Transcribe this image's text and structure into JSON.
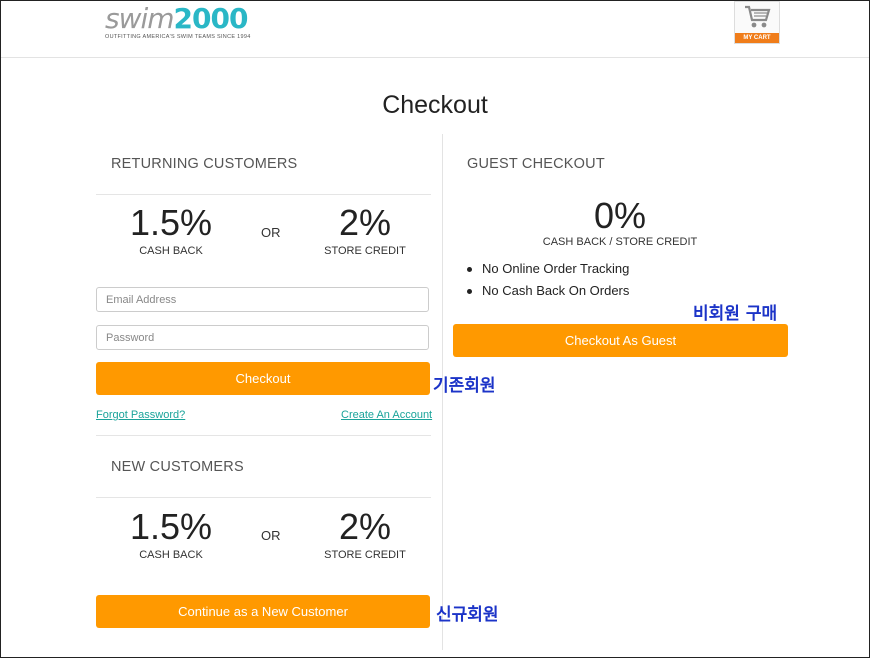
{
  "header": {
    "logo_word_1": "swim",
    "logo_word_2": "2000",
    "logo_tagline": "OUTFITTING AMERICA'S SWIM TEAMS SINCE 1994",
    "cart_label": "MY CART"
  },
  "page_title": "Checkout",
  "returning": {
    "title": "RETURNING CUSTOMERS",
    "cashback_value": "1.5%",
    "cashback_label": "CASH BACK",
    "or": "OR",
    "credit_value": "2%",
    "credit_label": "STORE CREDIT",
    "email_placeholder": "Email Address",
    "password_placeholder": "Password",
    "checkout_button": "Checkout",
    "forgot_link": "Forgot Password?",
    "create_link": "Create An Account"
  },
  "new_customers": {
    "title": "NEW CUSTOMERS",
    "cashback_value": "1.5%",
    "cashback_label": "CASH BACK",
    "or": "OR",
    "credit_value": "2%",
    "credit_label": "STORE CREDIT",
    "continue_button": "Continue as a New Customer"
  },
  "guest": {
    "title": "GUEST CHECKOUT",
    "value": "0%",
    "label": "CASH BACK / STORE CREDIT",
    "bullets": [
      "No Online Order Tracking",
      "No Cash Back On Orders"
    ],
    "button": "Checkout As Guest"
  },
  "annotations": {
    "guest": "비회원 구매",
    "existing": "기존회원",
    "new": "신규회원"
  },
  "colors": {
    "accent_button": "#ff9900",
    "link": "#1aa39a",
    "annotation": "#1c34c8"
  }
}
